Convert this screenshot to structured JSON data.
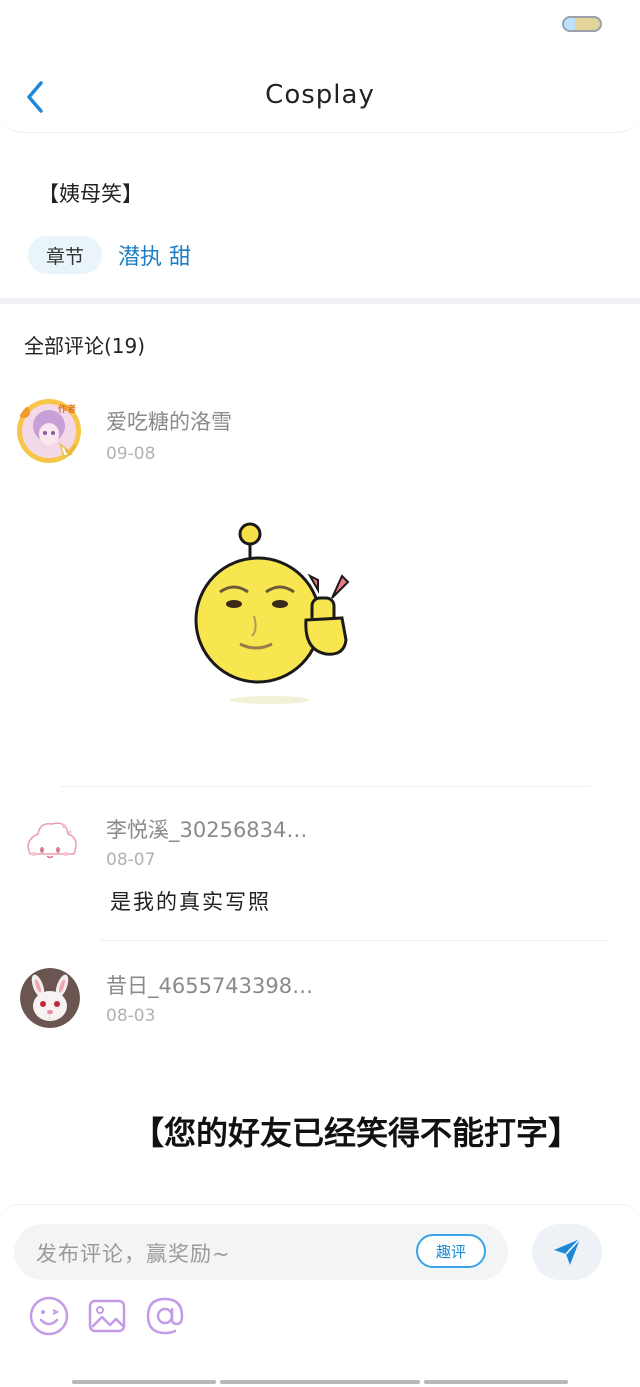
{
  "header": {
    "title": "Cosplay"
  },
  "chapter": {
    "quote": "【姨母笑】",
    "tag_label": "章节",
    "chapter_name": "潜执 甜"
  },
  "comments_section": {
    "title": "全部评论(19)"
  },
  "comments": [
    {
      "username": "爱吃糖的洛雪",
      "badge": "作者",
      "date": "09-08",
      "content_type": "sticker"
    },
    {
      "username": "李悦溪_30256834…",
      "date": "08-07",
      "text": "是我的真实写照"
    },
    {
      "username": "昔日_4655743398…",
      "date": "08-03",
      "image_caption": "【您的好友已经笑得不能打字】"
    }
  ],
  "composer": {
    "placeholder": "发布评论，赢奖励~",
    "qupin_label": "趣评"
  },
  "icons": {
    "back": "chevron-left-icon",
    "send": "send-icon",
    "emoji": "emoji-icon",
    "image": "image-icon",
    "mention": "at-icon"
  },
  "colors": {
    "accent": "#1d7fc6",
    "tool_icon": "#c39be6",
    "send_icon": "#1e88d8"
  }
}
